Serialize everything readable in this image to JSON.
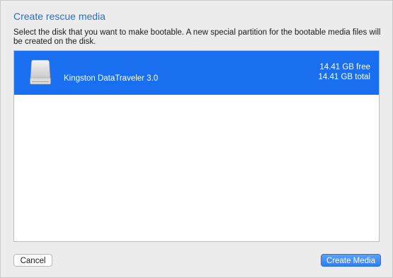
{
  "dialog": {
    "title": "Create rescue media",
    "description": "Select the disk that you want to make bootable. A new special partition for the bootable media files will be created on the disk."
  },
  "disks": [
    {
      "icon": "external-drive-icon",
      "name": "Kingston DataTraveler 3.0",
      "free": "14.41 GB free",
      "total": "14.41 GB total",
      "selected": true
    }
  ],
  "buttons": {
    "cancel_label": "Cancel",
    "create_label": "Create Media"
  },
  "colors": {
    "title": "#2a6fc2",
    "selection": "#1a6ef0",
    "primary_button": "#2e7ff2"
  }
}
